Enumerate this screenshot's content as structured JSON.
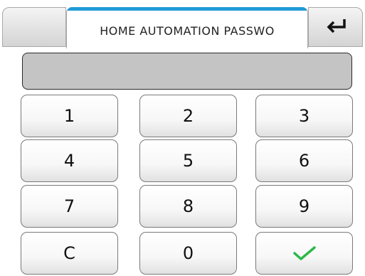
{
  "header": {
    "title": "HOME AUTOMATION PASSWO",
    "accent_color": "#1f9ad6",
    "back_icon": "enter-return-icon"
  },
  "display": {
    "value": "",
    "background": "#c4c4c4"
  },
  "keypad": {
    "keys": [
      "1",
      "2",
      "3",
      "4",
      "5",
      "6",
      "7",
      "8",
      "9",
      "C",
      "0"
    ],
    "confirm_icon": "checkmark-icon",
    "confirm_color": "#2db84a"
  }
}
